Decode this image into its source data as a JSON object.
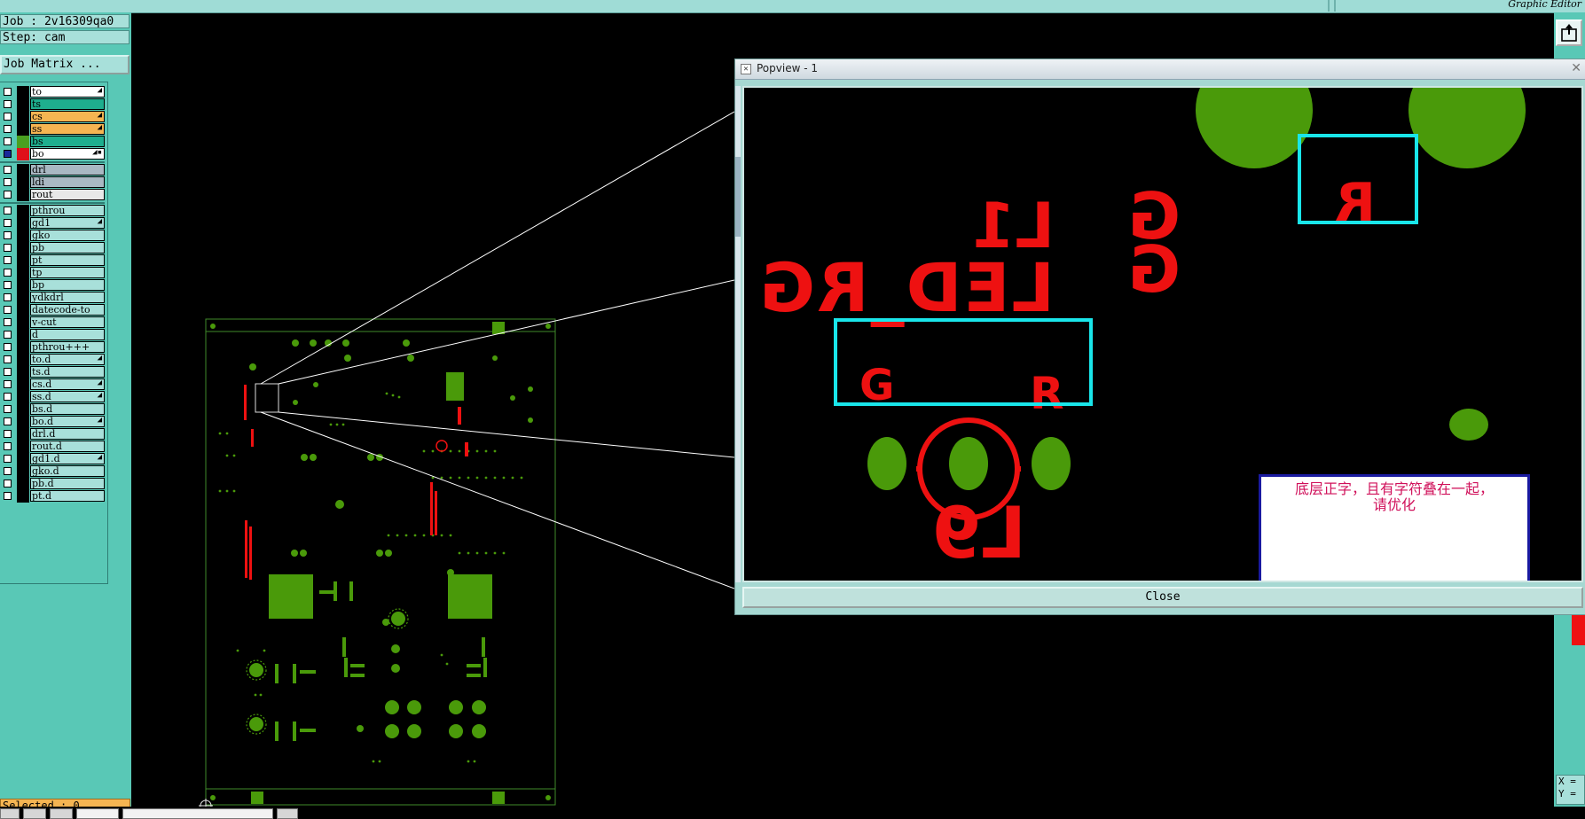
{
  "topbar": {
    "editor_label": "Graphic Editor"
  },
  "left_panel": {
    "job_line": "Job : 2v16309qa0",
    "step_line": "Step: cam",
    "job_matrix_label": "Job Matrix ...",
    "selected_label": "Selected : 0"
  },
  "layers": [
    {
      "name": "to",
      "color": "#ffffff",
      "swatch": "#000000",
      "checked": false,
      "marker": "◢"
    },
    {
      "name": "ts",
      "color": "#1eae8e",
      "swatch": "#000000",
      "checked": false,
      "marker": ""
    },
    {
      "name": "cs",
      "color": "#f5b552",
      "swatch": "#000000",
      "checked": false,
      "marker": "◢"
    },
    {
      "name": "ss",
      "color": "#f5b552",
      "swatch": "#000000",
      "checked": false,
      "marker": "◢"
    },
    {
      "name": "bs",
      "color": "#1eae8e",
      "swatch": "#4aa020",
      "checked": false,
      "marker": ""
    },
    {
      "name": "bo",
      "color": "#ffffff",
      "swatch": "#e0101a",
      "checked": true,
      "marker": "◢▪"
    },
    {
      "name": "drl",
      "color": "#a9b8c2",
      "swatch": "#000000",
      "checked": false,
      "marker": ""
    },
    {
      "name": "ldi",
      "color": "#a9b8c2",
      "swatch": "#000000",
      "checked": false,
      "marker": ""
    },
    {
      "name": "rout",
      "color": "#e8e8e8",
      "swatch": "#000000",
      "checked": false,
      "marker": ""
    },
    {
      "name": "pthrou",
      "color": "#a8e0da",
      "swatch": "#000000",
      "checked": false,
      "marker": ""
    },
    {
      "name": "gd1",
      "color": "#a8e0da",
      "swatch": "#000000",
      "checked": false,
      "marker": "◢"
    },
    {
      "name": "gko",
      "color": "#a8e0da",
      "swatch": "#000000",
      "checked": false,
      "marker": ""
    },
    {
      "name": "pb",
      "color": "#a8e0da",
      "swatch": "#000000",
      "checked": false,
      "marker": ""
    },
    {
      "name": "pt",
      "color": "#a8e0da",
      "swatch": "#000000",
      "checked": false,
      "marker": ""
    },
    {
      "name": "tp",
      "color": "#a8e0da",
      "swatch": "#000000",
      "checked": false,
      "marker": ""
    },
    {
      "name": "bp",
      "color": "#a8e0da",
      "swatch": "#000000",
      "checked": false,
      "marker": ""
    },
    {
      "name": "ydkdrl",
      "color": "#a8e0da",
      "swatch": "#000000",
      "checked": false,
      "marker": ""
    },
    {
      "name": "datecode-to",
      "color": "#a8e0da",
      "swatch": "#000000",
      "checked": false,
      "marker": ""
    },
    {
      "name": "v-cut",
      "color": "#a8e0da",
      "swatch": "#000000",
      "checked": false,
      "marker": ""
    },
    {
      "name": "d",
      "color": "#a8e0da",
      "swatch": "#000000",
      "checked": false,
      "marker": ""
    },
    {
      "name": "pthrou+++",
      "color": "#a8e0da",
      "swatch": "#000000",
      "checked": false,
      "marker": ""
    },
    {
      "name": "to.d",
      "color": "#a8e0da",
      "swatch": "#000000",
      "checked": false,
      "marker": "◢"
    },
    {
      "name": "ts.d",
      "color": "#a8e0da",
      "swatch": "#000000",
      "checked": false,
      "marker": ""
    },
    {
      "name": "cs.d",
      "color": "#a8e0da",
      "swatch": "#000000",
      "checked": false,
      "marker": "◢"
    },
    {
      "name": "ss.d",
      "color": "#a8e0da",
      "swatch": "#000000",
      "checked": false,
      "marker": "◢"
    },
    {
      "name": "bs.d",
      "color": "#a8e0da",
      "swatch": "#000000",
      "checked": false,
      "marker": ""
    },
    {
      "name": "bo.d",
      "color": "#a8e0da",
      "swatch": "#000000",
      "checked": false,
      "marker": "◢"
    },
    {
      "name": "drl.d",
      "color": "#a8e0da",
      "swatch": "#000000",
      "checked": false,
      "marker": ""
    },
    {
      "name": "rout.d",
      "color": "#a8e0da",
      "swatch": "#000000",
      "checked": false,
      "marker": ""
    },
    {
      "name": "gd1.d",
      "color": "#a8e0da",
      "swatch": "#000000",
      "checked": false,
      "marker": "◢"
    },
    {
      "name": "gko.d",
      "color": "#a8e0da",
      "swatch": "#000000",
      "checked": false,
      "marker": ""
    },
    {
      "name": "pb.d",
      "color": "#a8e0da",
      "swatch": "#000000",
      "checked": false,
      "marker": ""
    },
    {
      "name": "pt.d",
      "color": "#a8e0da",
      "swatch": "#000000",
      "checked": false,
      "marker": ""
    }
  ],
  "popview": {
    "title": "Popview - 1",
    "close_label": "Close",
    "mirrored_labels": {
      "l1": "L1",
      "led": "LED_RG",
      "g_top": "G",
      "g_bottom": "G",
      "l9": "L9",
      "r_box": "R"
    },
    "callout_labels": {
      "g": "G",
      "r": "R"
    },
    "note_line1": "底层正字，且有字符叠在一起，",
    "note_line2": "请优化"
  },
  "coords": {
    "x_label": "X =",
    "y_label": "Y ="
  },
  "colors": {
    "pcb_green": "#4a9a0a",
    "silk_red": "#ee1111",
    "highlight_cyan": "#19e6ea",
    "panel_teal": "#59c8b6"
  },
  "icons": [
    "close-icon",
    "window-icon",
    "checkbox-icon",
    "crosshair-icon",
    "export-icon"
  ]
}
